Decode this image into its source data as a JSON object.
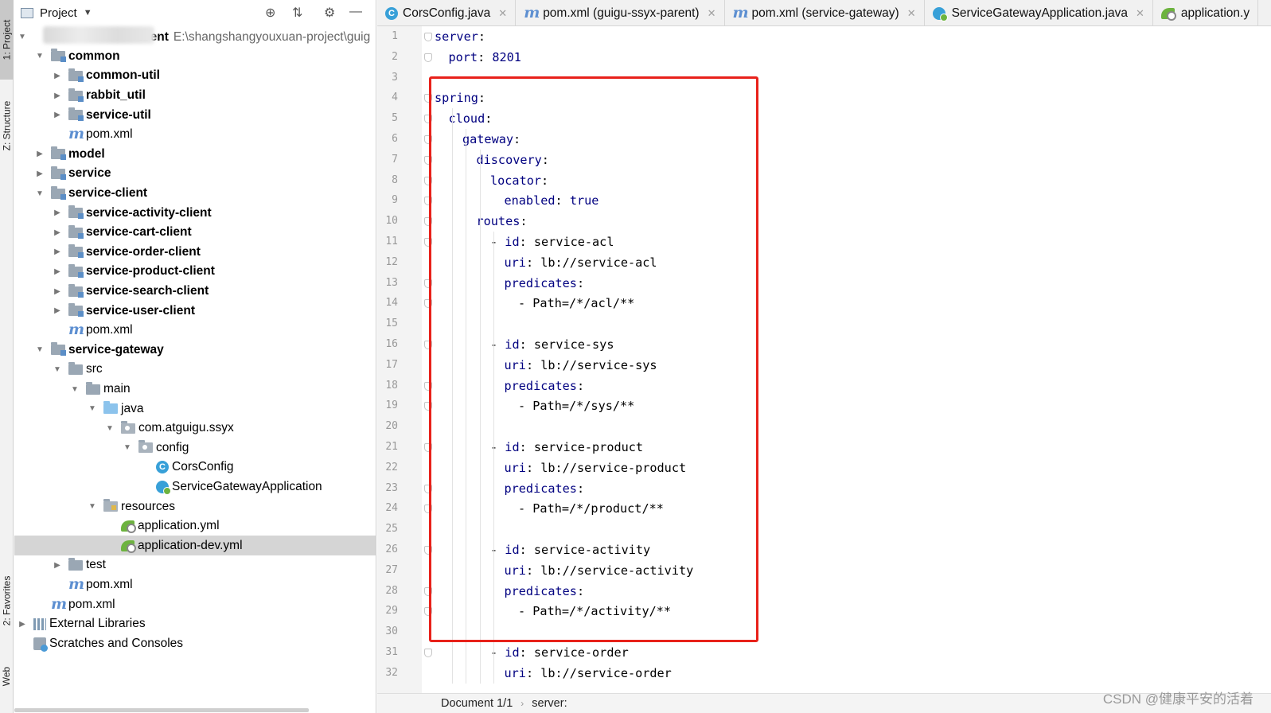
{
  "tool_strip": {
    "project": "1: Project",
    "structure": "Z: Structure",
    "favorites": "2: Favorites",
    "web": "Web"
  },
  "project_panel": {
    "title": "Project",
    "root": {
      "label": "arent",
      "path": "E:\\shangshangyouxuan-project\\guig"
    },
    "items": [
      {
        "label": "common",
        "icon": "module-folder-icon",
        "arrow": "expanded",
        "bold": true
      },
      {
        "label": "common-util",
        "icon": "module-folder-icon",
        "arrow": "collapsed",
        "bold": true
      },
      {
        "label": "rabbit_util",
        "icon": "module-folder-icon",
        "arrow": "collapsed",
        "bold": true
      },
      {
        "label": "service-util",
        "icon": "module-folder-icon",
        "arrow": "collapsed",
        "bold": true
      },
      {
        "label": "pom.xml",
        "icon": "maven-icon",
        "arrow": "none",
        "bold": false
      },
      {
        "label": "model",
        "icon": "module-folder-icon",
        "arrow": "collapsed",
        "bold": true
      },
      {
        "label": "service",
        "icon": "module-folder-icon",
        "arrow": "collapsed",
        "bold": true
      },
      {
        "label": "service-client",
        "icon": "module-folder-icon",
        "arrow": "expanded",
        "bold": true
      },
      {
        "label": "service-activity-client",
        "icon": "module-folder-icon",
        "arrow": "collapsed",
        "bold": true
      },
      {
        "label": "service-cart-client",
        "icon": "module-folder-icon",
        "arrow": "collapsed",
        "bold": true
      },
      {
        "label": "service-order-client",
        "icon": "module-folder-icon",
        "arrow": "collapsed",
        "bold": true
      },
      {
        "label": "service-product-client",
        "icon": "module-folder-icon",
        "arrow": "collapsed",
        "bold": true
      },
      {
        "label": "service-search-client",
        "icon": "module-folder-icon",
        "arrow": "collapsed",
        "bold": true
      },
      {
        "label": "service-user-client",
        "icon": "module-folder-icon",
        "arrow": "collapsed",
        "bold": true
      },
      {
        "label": "pom.xml",
        "icon": "maven-icon",
        "arrow": "none",
        "bold": false
      },
      {
        "label": "service-gateway",
        "icon": "module-folder-icon",
        "arrow": "expanded",
        "bold": true
      },
      {
        "label": "src",
        "icon": "folder-icon",
        "arrow": "expanded",
        "bold": false
      },
      {
        "label": "main",
        "icon": "folder-icon",
        "arrow": "expanded",
        "bold": false
      },
      {
        "label": "java",
        "icon": "source-folder-icon",
        "arrow": "expanded",
        "bold": false
      },
      {
        "label": "com.atguigu.ssyx",
        "icon": "package-icon",
        "arrow": "expanded",
        "bold": false
      },
      {
        "label": "config",
        "icon": "package-icon",
        "arrow": "expanded",
        "bold": false
      },
      {
        "label": "CorsConfig",
        "icon": "java-class-icon",
        "arrow": "none",
        "bold": false
      },
      {
        "label": "ServiceGatewayApplication",
        "icon": "spring-boot-app-icon",
        "arrow": "none",
        "bold": false
      },
      {
        "label": "resources",
        "icon": "resources-folder-icon",
        "arrow": "expanded",
        "bold": false
      },
      {
        "label": "application.yml",
        "icon": "spring-yml-icon",
        "arrow": "none",
        "bold": false
      },
      {
        "label": "application-dev.yml",
        "icon": "spring-yml-icon",
        "arrow": "none",
        "bold": false,
        "selected": true
      },
      {
        "label": "test",
        "icon": "folder-icon",
        "arrow": "collapsed",
        "bold": false
      },
      {
        "label": "pom.xml",
        "icon": "maven-icon",
        "arrow": "none",
        "bold": false
      },
      {
        "label": "pom.xml",
        "icon": "maven-icon",
        "arrow": "none",
        "bold": false
      },
      {
        "label": "External Libraries",
        "icon": "libraries-icon",
        "arrow": "collapsed",
        "bold": false
      },
      {
        "label": "Scratches and Consoles",
        "icon": "scratches-icon",
        "arrow": "none",
        "bold": false
      }
    ]
  },
  "tabs": [
    {
      "label": "CorsConfig.java",
      "icon": "java-class-icon",
      "close": true
    },
    {
      "label": "pom.xml (guigu-ssyx-parent)",
      "icon": "maven-icon",
      "close": true
    },
    {
      "label": "pom.xml (service-gateway)",
      "icon": "maven-icon",
      "close": true
    },
    {
      "label": "ServiceGatewayApplication.java",
      "icon": "spring-boot-app-icon",
      "close": true
    },
    {
      "label": "application.y",
      "icon": "spring-yml-icon",
      "close": false
    }
  ],
  "code_lines": [
    {
      "n": "1",
      "i": 0,
      "key": "server",
      "sep": ":",
      "val": "",
      "dash": false
    },
    {
      "n": "2",
      "i": 1,
      "key": "port",
      "sep": ": ",
      "val": "8201",
      "dash": false
    },
    {
      "n": "3",
      "i": 0,
      "key": "",
      "sep": "",
      "val": "",
      "dash": false
    },
    {
      "n": "4",
      "i": 0,
      "key": "spring",
      "sep": ":",
      "val": "",
      "dash": false
    },
    {
      "n": "5",
      "i": 1,
      "key": "cloud",
      "sep": ":",
      "val": "",
      "dash": false
    },
    {
      "n": "6",
      "i": 2,
      "key": "gateway",
      "sep": ":",
      "val": "",
      "dash": false
    },
    {
      "n": "7",
      "i": 3,
      "key": "discovery",
      "sep": ":",
      "val": "",
      "dash": false
    },
    {
      "n": "8",
      "i": 4,
      "key": "locator",
      "sep": ":",
      "val": "",
      "dash": false
    },
    {
      "n": "9",
      "i": 5,
      "key": "enabled",
      "sep": ": ",
      "val": "true",
      "dash": false
    },
    {
      "n": "10",
      "i": 3,
      "key": "routes",
      "sep": ":",
      "val": "",
      "dash": false
    },
    {
      "n": "11",
      "i": 4,
      "key": "id",
      "sep": ": ",
      "val": "service-acl",
      "dash": true
    },
    {
      "n": "12",
      "i": 5,
      "key": "uri",
      "sep": ": ",
      "val": "lb://service-acl",
      "dash": false
    },
    {
      "n": "13",
      "i": 5,
      "key": "predicates",
      "sep": ":",
      "val": "",
      "dash": false
    },
    {
      "n": "14",
      "i": 6,
      "key": "",
      "sep": "",
      "val": "- Path=/*/acl/**",
      "dash": false
    },
    {
      "n": "15",
      "i": 0,
      "key": "",
      "sep": "",
      "val": "",
      "dash": false
    },
    {
      "n": "16",
      "i": 4,
      "key": "id",
      "sep": ": ",
      "val": "service-sys",
      "dash": true
    },
    {
      "n": "17",
      "i": 5,
      "key": "uri",
      "sep": ": ",
      "val": "lb://service-sys",
      "dash": false
    },
    {
      "n": "18",
      "i": 5,
      "key": "predicates",
      "sep": ":",
      "val": "",
      "dash": false
    },
    {
      "n": "19",
      "i": 6,
      "key": "",
      "sep": "",
      "val": "- Path=/*/sys/**",
      "dash": false
    },
    {
      "n": "20",
      "i": 0,
      "key": "",
      "sep": "",
      "val": "",
      "dash": false
    },
    {
      "n": "21",
      "i": 4,
      "key": "id",
      "sep": ": ",
      "val": "service-product",
      "dash": true
    },
    {
      "n": "22",
      "i": 5,
      "key": "uri",
      "sep": ": ",
      "val": "lb://service-product",
      "dash": false
    },
    {
      "n": "23",
      "i": 5,
      "key": "predicates",
      "sep": ":",
      "val": "",
      "dash": false
    },
    {
      "n": "24",
      "i": 6,
      "key": "",
      "sep": "",
      "val": "- Path=/*/product/**",
      "dash": false
    },
    {
      "n": "25",
      "i": 0,
      "key": "",
      "sep": "",
      "val": "",
      "dash": false
    },
    {
      "n": "26",
      "i": 4,
      "key": "id",
      "sep": ": ",
      "val": "service-activity",
      "dash": true
    },
    {
      "n": "27",
      "i": 5,
      "key": "uri",
      "sep": ": ",
      "val": "lb://service-activity",
      "dash": false
    },
    {
      "n": "28",
      "i": 5,
      "key": "predicates",
      "sep": ":",
      "val": "",
      "dash": false
    },
    {
      "n": "29",
      "i": 6,
      "key": "",
      "sep": "",
      "val": "- Path=/*/activity/**",
      "dash": false
    },
    {
      "n": "30",
      "i": 0,
      "key": "",
      "sep": "",
      "val": "",
      "dash": false
    },
    {
      "n": "31",
      "i": 4,
      "key": "id",
      "sep": ": ",
      "val": "service-order",
      "dash": true
    },
    {
      "n": "32",
      "i": 5,
      "key": "uri",
      "sep": ": ",
      "val": "lb://service-order",
      "dash": false
    }
  ],
  "breadcrumb": {
    "doc": "Document 1/1",
    "path": "server:"
  },
  "watermark": "CSDN @健康平安的活着",
  "colors": {
    "key": "#000080",
    "highlight_box": "#e8211a",
    "selection": "#d5d5d5"
  }
}
